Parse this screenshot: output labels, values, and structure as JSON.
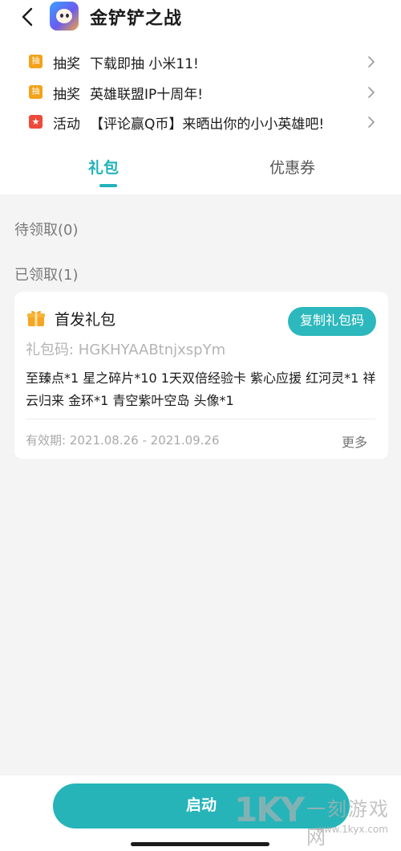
{
  "app": {
    "title": "金铲铲之战",
    "icon": "game-app-icon"
  },
  "promos": [
    {
      "icon": "lottery-tag-icon",
      "icon_text": "抽",
      "kind": "抽奖",
      "text": "下载即抽 小米11!"
    },
    {
      "icon": "lottery-tag-icon",
      "icon_text": "抽",
      "kind": "抽奖",
      "text": "英雄联盟IP十周年!"
    },
    {
      "icon": "activity-bookmark-icon",
      "icon_text": "★",
      "kind": "活动",
      "text": "【评论赢Q币】来晒出你的小小英雄吧!"
    }
  ],
  "tabs": {
    "active": "礼包",
    "inactive": "优惠券"
  },
  "sections": {
    "pending": "待领取(0)",
    "claimed": "已领取(1)"
  },
  "gift_card": {
    "title": "首发礼包",
    "copy_button": "复制礼包码",
    "code": "礼包码: HGKHYAABtnjxspYm",
    "contents": "至臻点*1 星之碎片*10 1天双倍经验卡 紫心应援 红河灵*1 祥云归来 金环*1 青空紫叶空岛 头像*1",
    "validity": "有效期: 2021.08.26 - 2021.09.26",
    "more": "更多"
  },
  "launch_button": "启动",
  "watermark": {
    "logo": "1KY",
    "name": "一刻游戏网",
    "url": "www.1kyx.com"
  },
  "colors": {
    "accent": "#26b4b9",
    "lottery_tag": "#f3a21a",
    "activity_tag": "#ec4a3a",
    "gift_icon": "#f5a623"
  }
}
